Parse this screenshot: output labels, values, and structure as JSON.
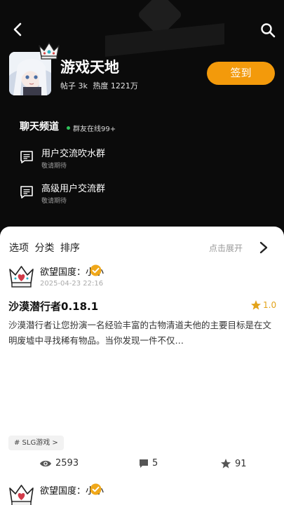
{
  "header": {
    "forum_title": "游戏天地",
    "posts": "帖子 3k",
    "heat": "热度 1221万",
    "signin_label": "签到"
  },
  "channel": {
    "title": "聊天频道",
    "online": "群友在线99+",
    "groups": [
      {
        "name": "用户交流吹水群",
        "sub": "敬请期待"
      },
      {
        "name": "高级用户交流群",
        "sub": "敬请期待"
      }
    ]
  },
  "filter": {
    "options": [
      "选项",
      "分类",
      "排序"
    ],
    "expand_hint": "点击展开"
  },
  "posts": [
    {
      "author": "欲望国度：小小",
      "time": "2025-04-23 22:16",
      "title": "沙漠潜行者0.18.1",
      "rating": "1.0",
      "body": "沙漠潜行者让您扮演一名经验丰富的古物清道夫他的主要目标是在文明废墟中寻找稀有物品。当你发现一件不仅…",
      "tag": "# SLG游戏 >",
      "views": "2593",
      "comments": "5",
      "stars": "91"
    },
    {
      "author": "欲望国度：小小"
    }
  ],
  "colors": {
    "accent": "#f39a0b",
    "online_dot": "#2fc25b",
    "rating": "#e3a31a"
  }
}
